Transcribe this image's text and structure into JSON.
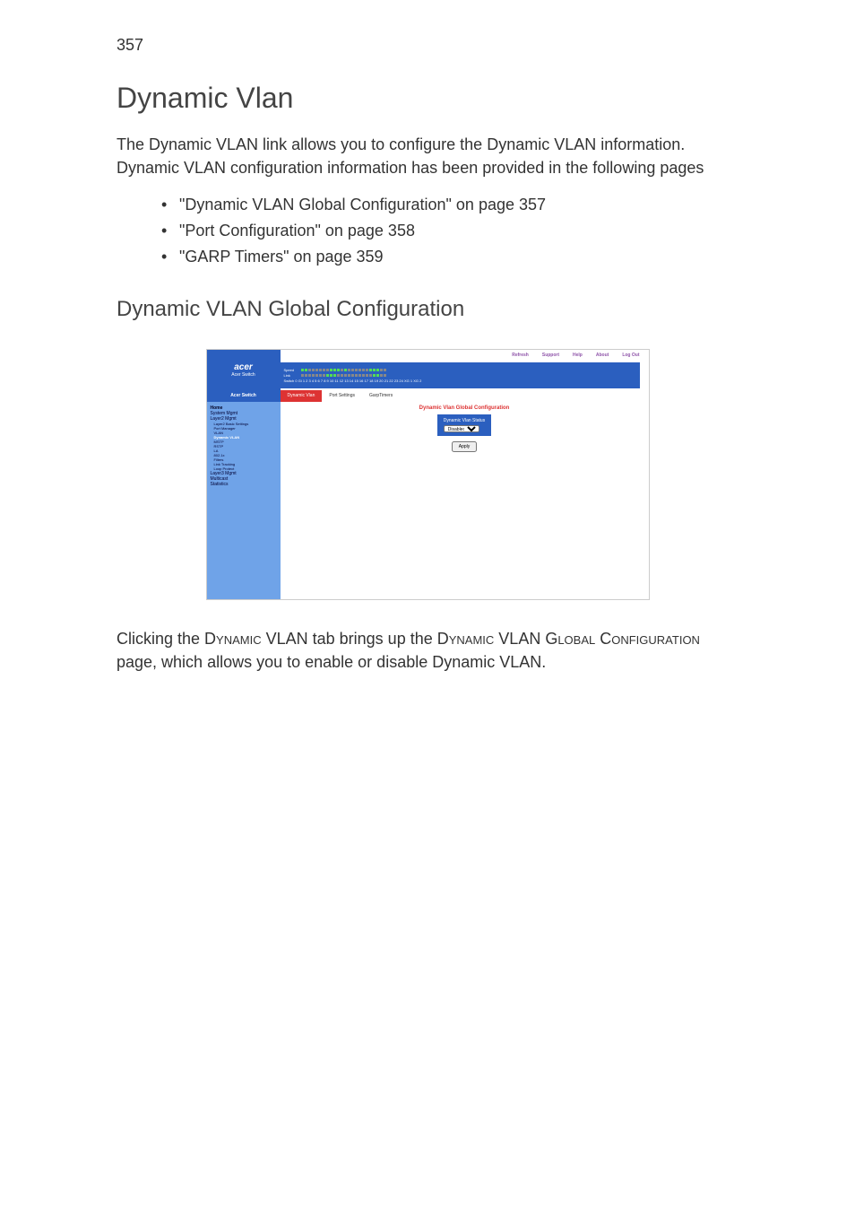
{
  "page_number": "357",
  "heading": "Dynamic Vlan",
  "intro": "The Dynamic VLAN link allows you to configure the Dynamic VLAN information. Dynamic VLAN configuration information has been provided in the following pages",
  "bullets": [
    "\"Dynamic VLAN Global Configuration\" on page 357",
    "\"Port Configuration\" on page 358",
    "\"GARP Timers\" on page 359"
  ],
  "subheading": "Dynamic VLAN Global Configuration",
  "closing": {
    "p1a": "Clicking the ",
    "p1b": "Dynamic",
    "p1c": " VLAN tab brings up the ",
    "p1d": "Dynamic",
    "p1e": " VLAN ",
    "p1f": "Global Configuration",
    "p1g": " page, which allows you to enable or disable Dynamic VLAN."
  },
  "screenshot": {
    "brand": "acer",
    "brand_sub": "Acer Switch",
    "top_links": [
      "Refresh",
      "Support",
      "Help",
      "About",
      "Log Out"
    ],
    "port_labels": {
      "speed": "Speed",
      "link": "Link",
      "switch": "Switch 0 Gi 1 2 3 4 5 6 7 8 9 10 11 12 13 14 15 16 17 18 19 20 21 22 23 24 XG 1 XG 2"
    },
    "sidebar_title": "Acer Switch",
    "tabs": [
      "Dynamic Vlan",
      "Port Settings",
      "GarpTimers"
    ],
    "nav": {
      "home": "Home",
      "items": [
        {
          "label": "System Mgmt",
          "subs": []
        },
        {
          "label": "Layer2 Mgmt",
          "subs": [
            "Layer2 Basic Settings",
            "Port Manager",
            "VLAN",
            "Dynamic VLAN",
            "MSTP",
            "RSTP",
            "LA",
            "802.1x",
            "Filters",
            "Link Tracking",
            "Loop Protect"
          ]
        },
        {
          "label": "Layer3 Mgmt",
          "subs": []
        },
        {
          "label": "Multicast",
          "subs": []
        },
        {
          "label": "Statistics",
          "subs": []
        }
      ],
      "active_sub": "Dynamic VLAN"
    },
    "panel_title": "Dynamic Vlan Global Configuration",
    "field_label": "Dynamic Vlan Status",
    "field_value": "Disabled",
    "apply": "Apply"
  }
}
